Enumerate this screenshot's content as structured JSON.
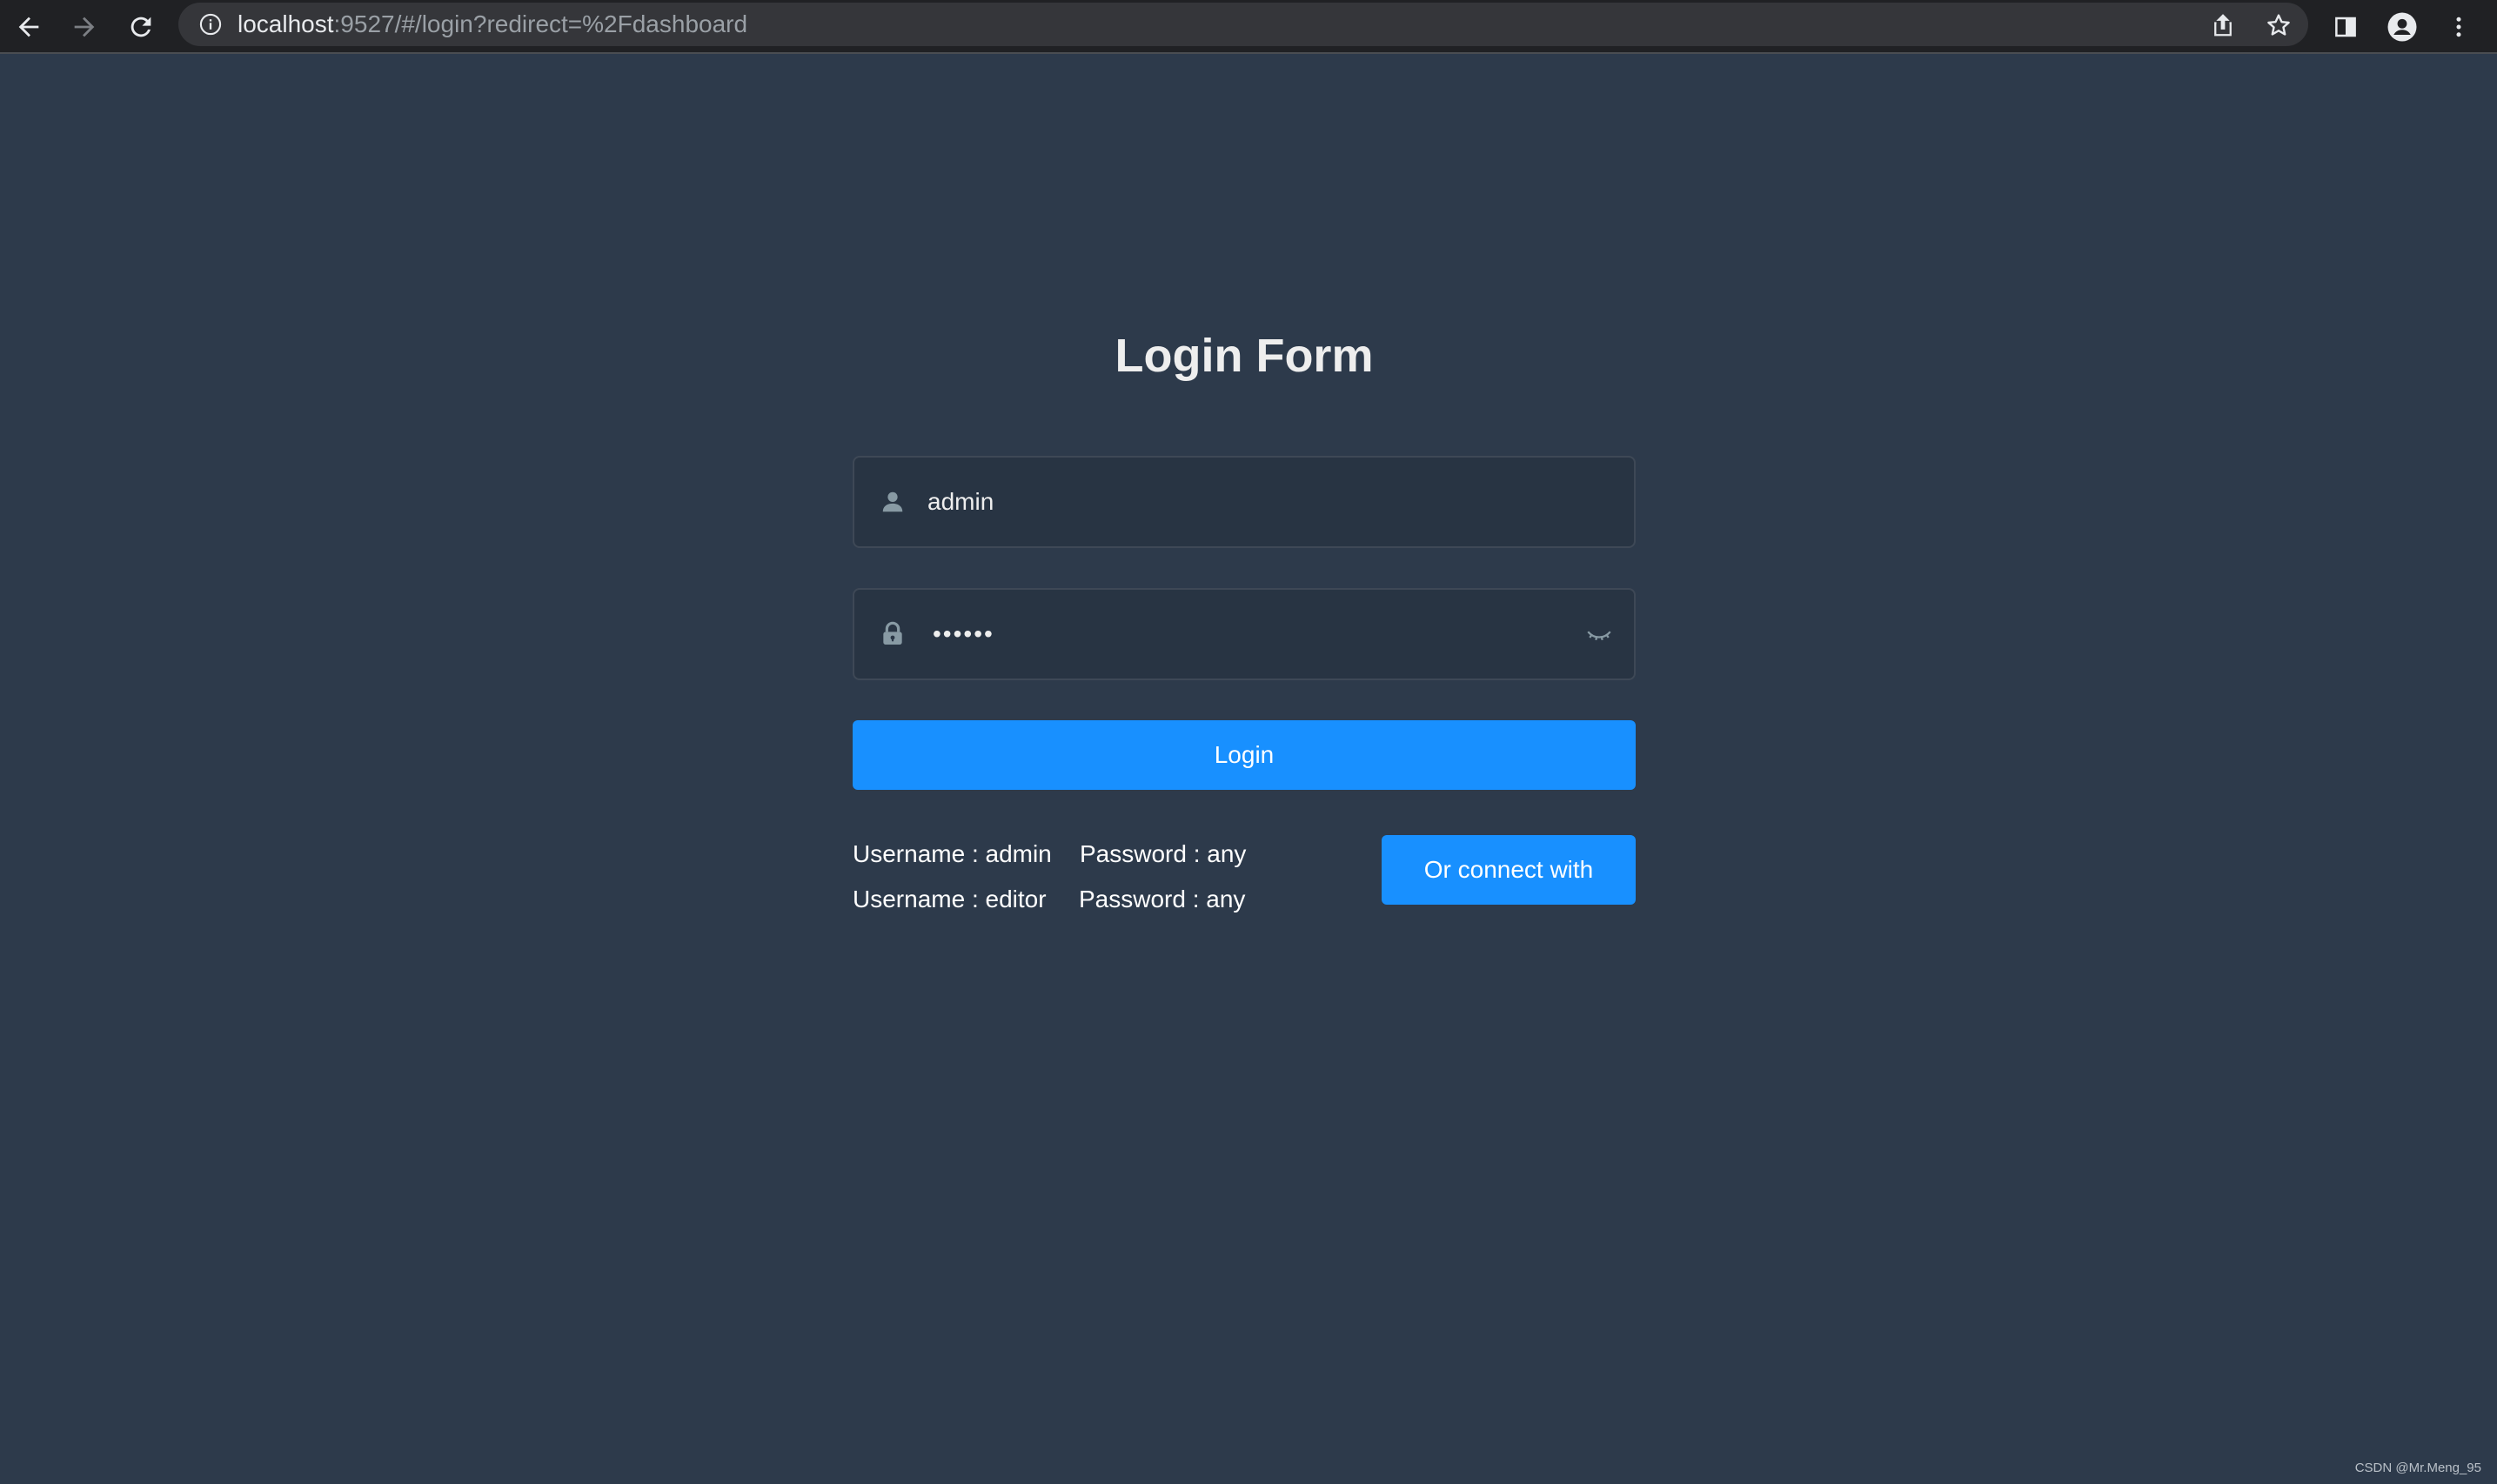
{
  "browser": {
    "url_host": "localhost",
    "url_rest": ":9527/#/login?redirect=%2Fdashboard",
    "icons": [
      "back-arrow-icon",
      "forward-arrow-icon",
      "reload-icon",
      "info-icon",
      "share-icon",
      "star-icon",
      "side-panel-icon",
      "profile-icon",
      "more-vertical-icon"
    ]
  },
  "login": {
    "title": "Login Form",
    "username": {
      "value": "admin",
      "icon": "user-icon"
    },
    "password": {
      "masked": "••••••",
      "icon": "lock-icon",
      "toggle_icon": "eye-closed-icon"
    },
    "login_label": "Login",
    "tips": [
      {
        "username": "Username : admin",
        "password": "Password : any"
      },
      {
        "username": "Username : editor",
        "password": "Password : any"
      }
    ],
    "connect_label": "Or connect with"
  },
  "watermark": "CSDN @Mr.Meng_95",
  "colors": {
    "background": "#2d3a4b",
    "primary": "#1890ff",
    "text": "#eeeeee",
    "icon": "#889aa4"
  }
}
